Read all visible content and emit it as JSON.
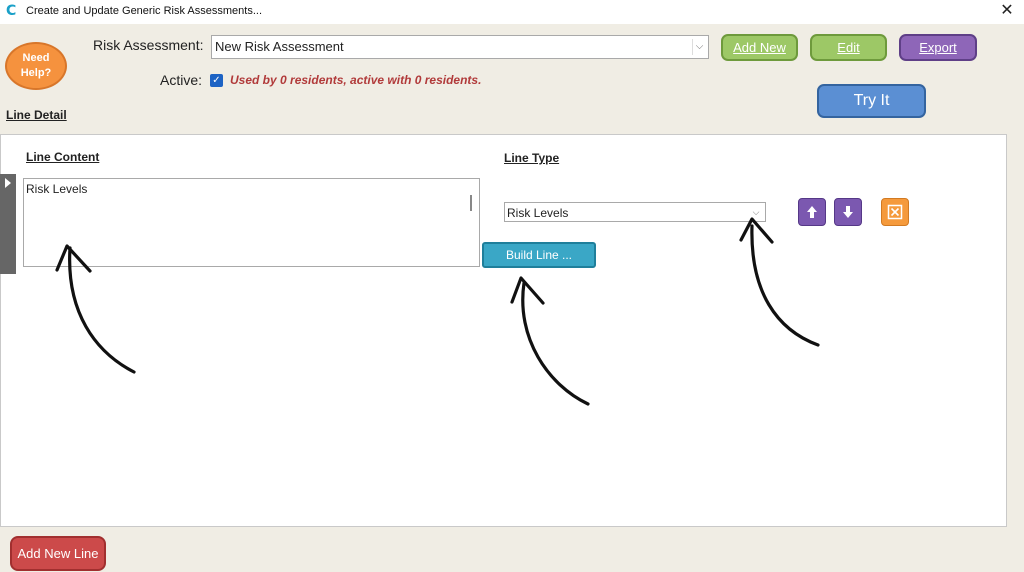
{
  "window": {
    "title": "Create and Update Generic Risk Assessments...",
    "app_icon": "C",
    "close": "✕"
  },
  "help": {
    "label": "Need Help?"
  },
  "header": {
    "risk_label": "Risk Assessment:",
    "risk_value": "New Risk Assessment",
    "add_new": "Add New",
    "edit": "Edit",
    "export": "Export",
    "active_label": "Active:",
    "active_checked": true,
    "usage_text": "Used by 0 residents, active with 0 residents.",
    "try_it": "Try It",
    "line_detail": "Line Detail"
  },
  "detail": {
    "line_content_label": "Line Content",
    "line_content_value": "Risk Levels",
    "line_type_label": "Line Type",
    "line_type_value": "Risk Levels",
    "build_line": "Build Line ..."
  },
  "footer": {
    "add_new_line": "Add New Line"
  },
  "colors": {
    "green": "#9dc866",
    "purple": "#8e66b8",
    "blue": "#5b8fd3",
    "red": "#cc4a4a",
    "orange": "#f5923e",
    "teal": "#3aa7c6"
  },
  "icons": [
    "app-logo-icon",
    "close-icon",
    "chevron-down-icon",
    "checkbox-icon",
    "record-selector-icon",
    "arrow-up-icon",
    "arrow-down-icon",
    "delete-icon",
    "annotation-arrow"
  ]
}
